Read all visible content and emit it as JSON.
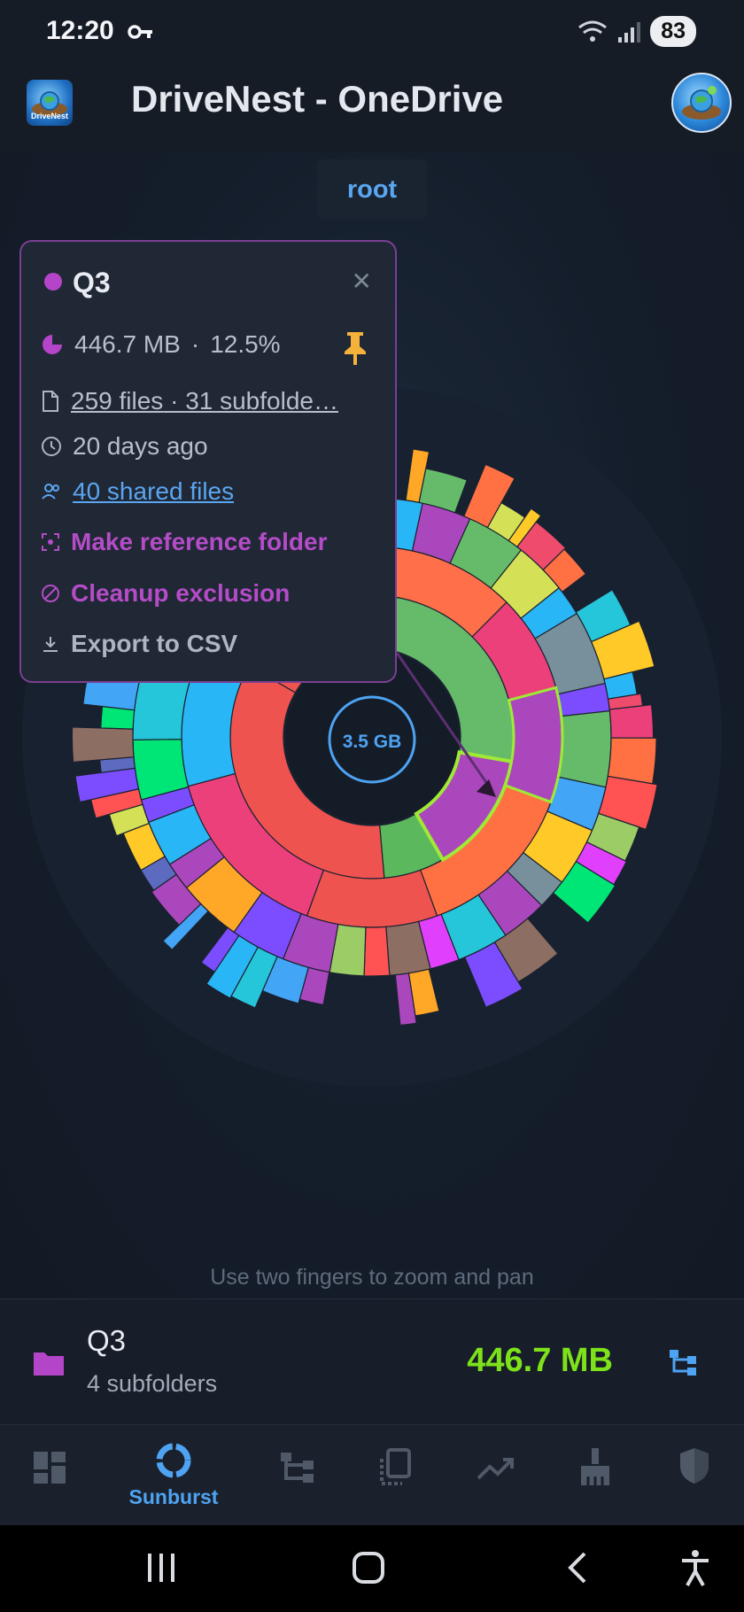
{
  "status_bar": {
    "time": "12:20",
    "battery": "83"
  },
  "app_bar": {
    "title": "DriveNest - OneDrive",
    "logo_text": "DriveNest"
  },
  "breadcrumb": {
    "root_label": "root"
  },
  "sunburst": {
    "center_label": "3.5 GB",
    "hint": "Use two fingers to zoom and pan"
  },
  "popup": {
    "title": "Q3",
    "size": "446.7 MB",
    "separator": "·",
    "percent": "12.5%",
    "files": "259 files",
    "subfolders": "31 subfolde…",
    "modified": "20 days ago",
    "shared": "40 shared files",
    "actions": [
      "Make reference folder",
      "Cleanup exclusion",
      "Export to CSV"
    ],
    "accent_color": "#b445c8"
  },
  "selected": {
    "name": "Q3",
    "subtitle": "4 subfolders",
    "size": "446.7 MB"
  },
  "nav": {
    "items": [
      "dashboard",
      "Sunburst",
      "tree",
      "duplicates",
      "trends",
      "cleanup",
      "security"
    ],
    "active_label": "Sunburst"
  },
  "colors": {
    "accent": "#4ea3f2",
    "size_green": "#7ee21a",
    "selection": "#9fea34"
  }
}
